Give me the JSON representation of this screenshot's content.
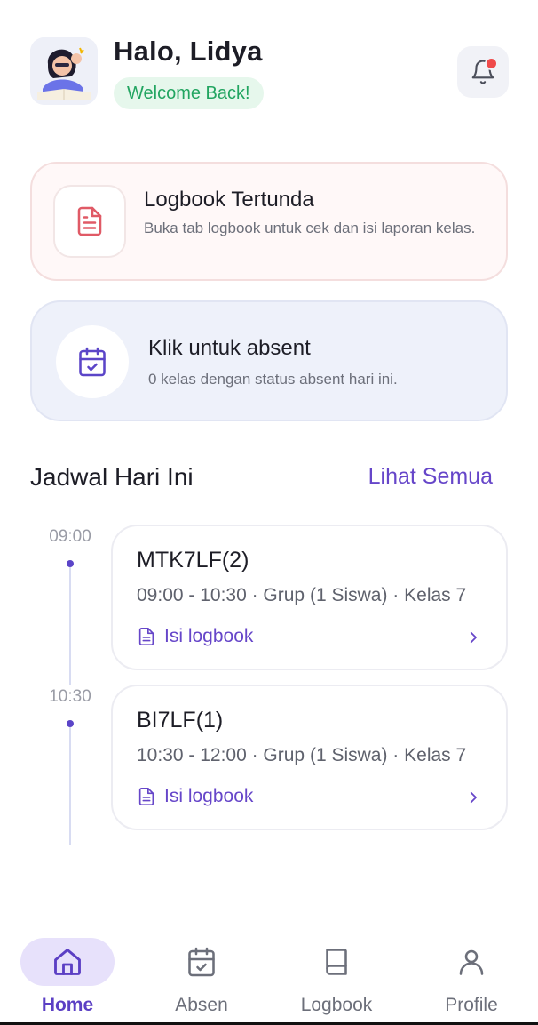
{
  "header": {
    "greeting": "Halo, Lidya",
    "welcome": "Welcome Back!"
  },
  "pending_card": {
    "title": "Logbook Tertunda",
    "subtitle": "Buka tab logbook untuk cek dan isi laporan kelas."
  },
  "absent_card": {
    "title": "Klik untuk absent",
    "subtitle": "0 kelas dengan status absent hari ini."
  },
  "schedule": {
    "title": "Jadwal Hari Ini",
    "see_all": "Lihat Semua",
    "items": [
      {
        "time": "09:00",
        "code": "MTK7LF(2)",
        "info": "09:00 - 10:30 · Grup (1 Siswa) · Kelas 7",
        "action": "Isi logbook"
      },
      {
        "time": "10:30",
        "code": "BI7LF(1)",
        "info": "10:30 - 12:00 · Grup (1 Siswa) · Kelas 7",
        "action": "Isi logbook"
      }
    ]
  },
  "nav": {
    "items": [
      {
        "label": "Home",
        "icon": "home-icon",
        "active": true
      },
      {
        "label": "Absen",
        "icon": "calendar-check-icon",
        "active": false
      },
      {
        "label": "Logbook",
        "icon": "book-icon",
        "active": false
      },
      {
        "label": "Profile",
        "icon": "user-icon",
        "active": false
      }
    ]
  },
  "colors": {
    "accent": "#6646c9",
    "welcome_bg": "#e6f7ec",
    "welcome_text": "#22a561",
    "notification_dot": "#ef4a4a",
    "pending_icon": "#e05a66"
  }
}
